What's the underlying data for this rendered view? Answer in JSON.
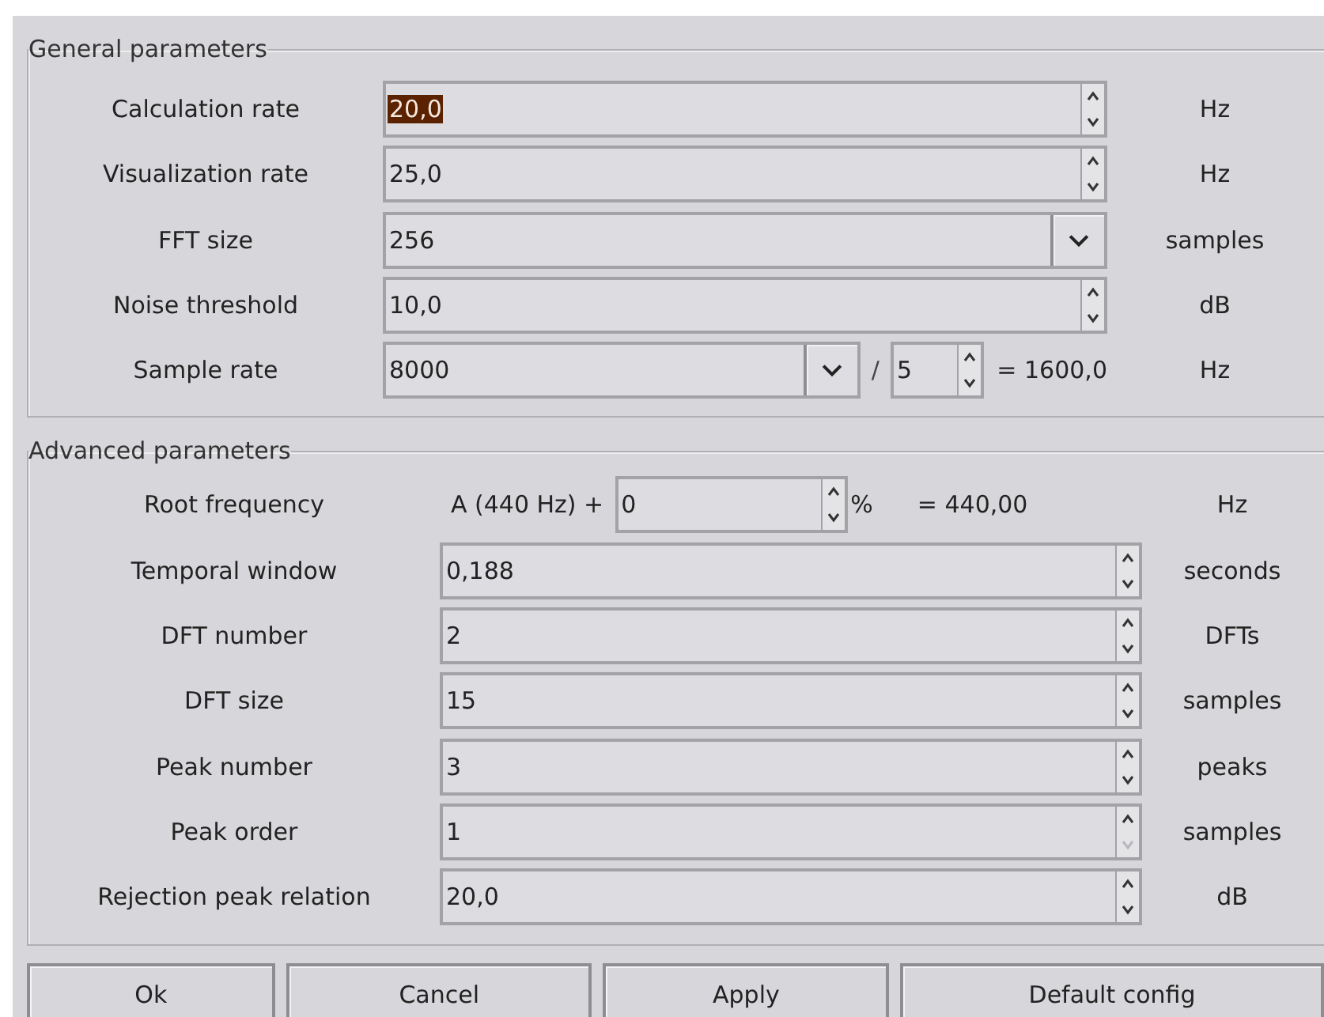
{
  "general": {
    "title": "General parameters",
    "rows": [
      {
        "kind": "spin",
        "label": "Calculation rate",
        "value": "20,0",
        "value_selected": true,
        "down_disabled": false,
        "unit": "Hz"
      },
      {
        "kind": "spin",
        "label": "Visualization rate",
        "value": "25,0",
        "value_selected": false,
        "down_disabled": false,
        "unit": "Hz"
      },
      {
        "kind": "combo",
        "label": "FFT size",
        "value": "256",
        "unit": "samples"
      },
      {
        "kind": "spin",
        "label": "Noise threshold",
        "value": "10,0",
        "value_selected": false,
        "down_disabled": false,
        "unit": "dB"
      },
      {
        "kind": "ratio",
        "label": "Sample rate",
        "value": "8000",
        "operator": "/",
        "divisor": "5",
        "result": "= 1600,0",
        "unit": "Hz"
      }
    ]
  },
  "advanced": {
    "title": "Advanced parameters",
    "rows": [
      {
        "kind": "offset",
        "label": "Root frequency",
        "prefix": "A (440 Hz) +",
        "value": "0",
        "suffix": "%",
        "result": "= 440,00",
        "unit": "Hz"
      },
      {
        "kind": "spin",
        "label": "Temporal window",
        "value": "0,188",
        "value_selected": false,
        "down_disabled": false,
        "unit": "seconds"
      },
      {
        "kind": "spin",
        "label": "DFT number",
        "value": "2",
        "value_selected": false,
        "down_disabled": false,
        "unit": "DFTs"
      },
      {
        "kind": "spin",
        "label": "DFT size",
        "value": "15",
        "value_selected": false,
        "down_disabled": false,
        "unit": "samples"
      },
      {
        "kind": "spin",
        "label": "Peak number",
        "value": "3",
        "value_selected": false,
        "down_disabled": false,
        "unit": "peaks"
      },
      {
        "kind": "spin",
        "label": "Peak order",
        "value": "1",
        "value_selected": false,
        "down_disabled": true,
        "unit": "samples"
      },
      {
        "kind": "spin",
        "label": "Rejection peak relation",
        "value": "20,0",
        "value_selected": false,
        "down_disabled": false,
        "unit": "dB"
      }
    ]
  },
  "buttons": [
    "Ok",
    "Cancel",
    "Apply",
    "Default config"
  ]
}
